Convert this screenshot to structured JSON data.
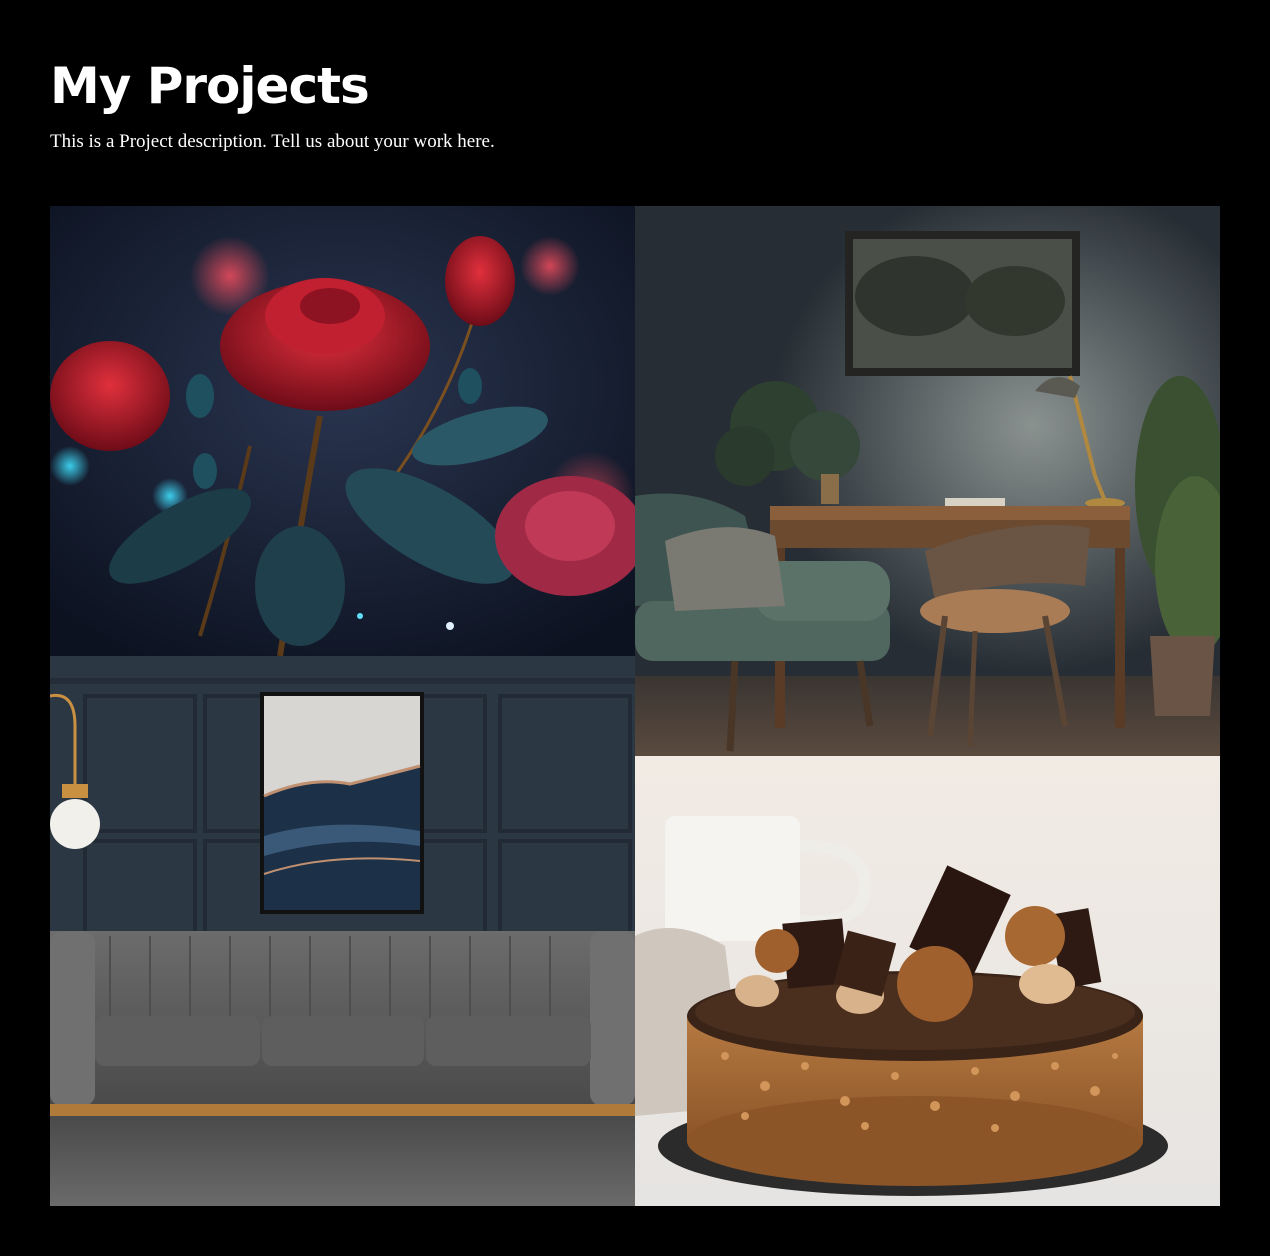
{
  "header": {
    "title": "My Projects",
    "description": "This is a Project description. Tell us about your work here."
  },
  "gallery": {
    "items": [
      {
        "name": "roses-artwork",
        "subject": "glowing red roses on dark background"
      },
      {
        "name": "home-office",
        "subject": "dark home office with armchair, desk, lamp and plant"
      },
      {
        "name": "living-room",
        "subject": "navy paneled wall with abstract art, pendant lamp and grey velvet sofa"
      },
      {
        "name": "chocolate-cake",
        "subject": "chocolate cake topped with truffles and chocolate chunks"
      }
    ]
  },
  "colors": {
    "background": "#000000",
    "text": "#ffffff",
    "rose": "#b01a2a",
    "wall_navy": "#2c3744",
    "armchair": "#4d6259",
    "cake": "#a9703e"
  }
}
